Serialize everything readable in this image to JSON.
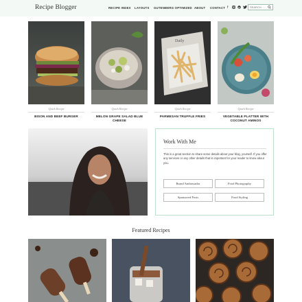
{
  "header": {
    "logo": "Recipe Blogger",
    "nav": [
      "RECIPE INDEX",
      "LAYOUTS",
      "GUTENBERG OPTIMIZED",
      "ABOUT",
      "CONTACT"
    ],
    "social_icons": [
      "facebook-icon",
      "instagram-icon",
      "pinterest-icon",
      "twitter-icon"
    ],
    "search_placeholder": "SEARCH"
  },
  "cards": [
    {
      "category": "Quick Recipe",
      "title": "BISON AND BEEF BURGER"
    },
    {
      "category": "Quick Recipe",
      "title": "MELON GRAPE SALAD BLUE CHEESE"
    },
    {
      "category": "Quick Recipe",
      "title": "PARMESAN TRUFFLE FRIES"
    },
    {
      "category": "Quick Recipe",
      "title": "VEGETABLE PLATTER WITH COCONUT AMINOS"
    }
  ],
  "work": {
    "title": "Work With Me",
    "body": "This is a great section to share some details about your blog, yourself. If you offer any services or any other details that is important for your reader to know about you.",
    "buttons": [
      "Brand Ambassador",
      "Food Photography",
      "Sponsored Posts",
      "Food Styling"
    ]
  },
  "featured": {
    "title": "Featured Recipes"
  },
  "colors": {
    "header_bg": "#f3faf6",
    "accent_border": "#bfe0cc"
  }
}
